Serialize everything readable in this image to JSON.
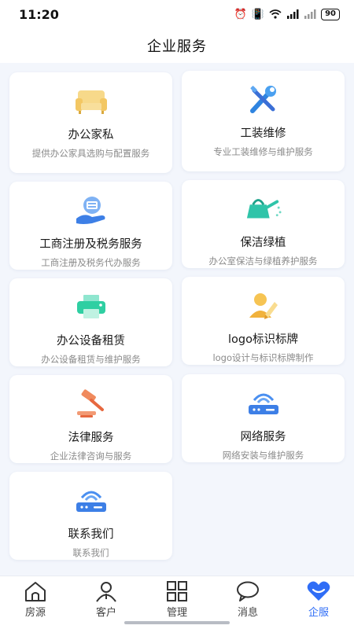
{
  "status": {
    "time": "11:20",
    "battery": "90"
  },
  "header": {
    "title": "企业服务"
  },
  "services": [
    {
      "name": "办公家私",
      "desc": "提供办公家具选购与配置服务",
      "icon": "sofa-icon"
    },
    {
      "name": "工装维修",
      "desc": "专业工装维修与维护服务",
      "icon": "wrench-screwdriver-icon"
    },
    {
      "name": "工商注册及税务服务",
      "desc": "工商注册及税务代办服务",
      "icon": "tax-hand-icon"
    },
    {
      "name": "保洁绿植",
      "desc": "办公室保洁与绿植养护服务",
      "icon": "watering-can-icon"
    },
    {
      "name": "办公设备租赁",
      "desc": "办公设备租赁与维护服务",
      "icon": "printer-icon"
    },
    {
      "name": "logo标识标牌",
      "desc": "logo设计与标识标牌制作",
      "icon": "person-pen-icon"
    },
    {
      "name": "法律服务",
      "desc": "企业法律咨询与服务",
      "icon": "gavel-icon"
    },
    {
      "name": "网络服务",
      "desc": "网络安装与维护服务",
      "icon": "router-icon"
    },
    {
      "name": "联系我们",
      "desc": "联系我们",
      "icon": "router-icon"
    }
  ],
  "tabs": [
    {
      "label": "房源",
      "icon": "house-icon"
    },
    {
      "label": "客户",
      "icon": "user-icon"
    },
    {
      "label": "管理",
      "icon": "grid-icon"
    },
    {
      "label": "消息",
      "icon": "chat-bubble-icon"
    },
    {
      "label": "企服",
      "icon": "heart-icon",
      "active": true
    }
  ],
  "colors": {
    "accent": "#2f6df6",
    "background": "#f3f6fc"
  }
}
